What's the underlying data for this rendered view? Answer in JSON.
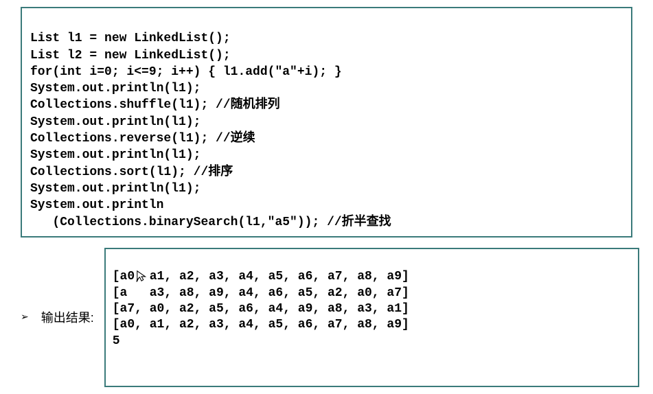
{
  "code": {
    "lines": [
      "List l1 = new LinkedList();",
      "List l2 = new LinkedList();",
      "for(int i=0; i<=9; i++) { l1.add(\"a\"+i); }",
      "System.out.println(l1);",
      "Collections.shuffle(l1); //随机排列",
      "System.out.println(l1);",
      "Collections.reverse(l1); //逆续",
      "System.out.println(l1);",
      "Collections.sort(l1); //排序",
      "System.out.println(l1);",
      "System.out.println",
      "   (Collections.binarySearch(l1,\"a5\")); //折半查找"
    ]
  },
  "output": {
    "bullet": "➢",
    "label": "输出结果:",
    "lines": [
      "[a0, a1, a2, a3, a4, a5, a6, a7, a8, a9]",
      "[a   a3, a8, a9, a4, a6, a5, a2, a0, a7]",
      "[a7, a0, a2, a5, a6, a4, a9, a8, a3, a1]",
      "[a0, a1, a2, a3, a4, a5, a6, a7, a8, a9]",
      "5"
    ]
  }
}
